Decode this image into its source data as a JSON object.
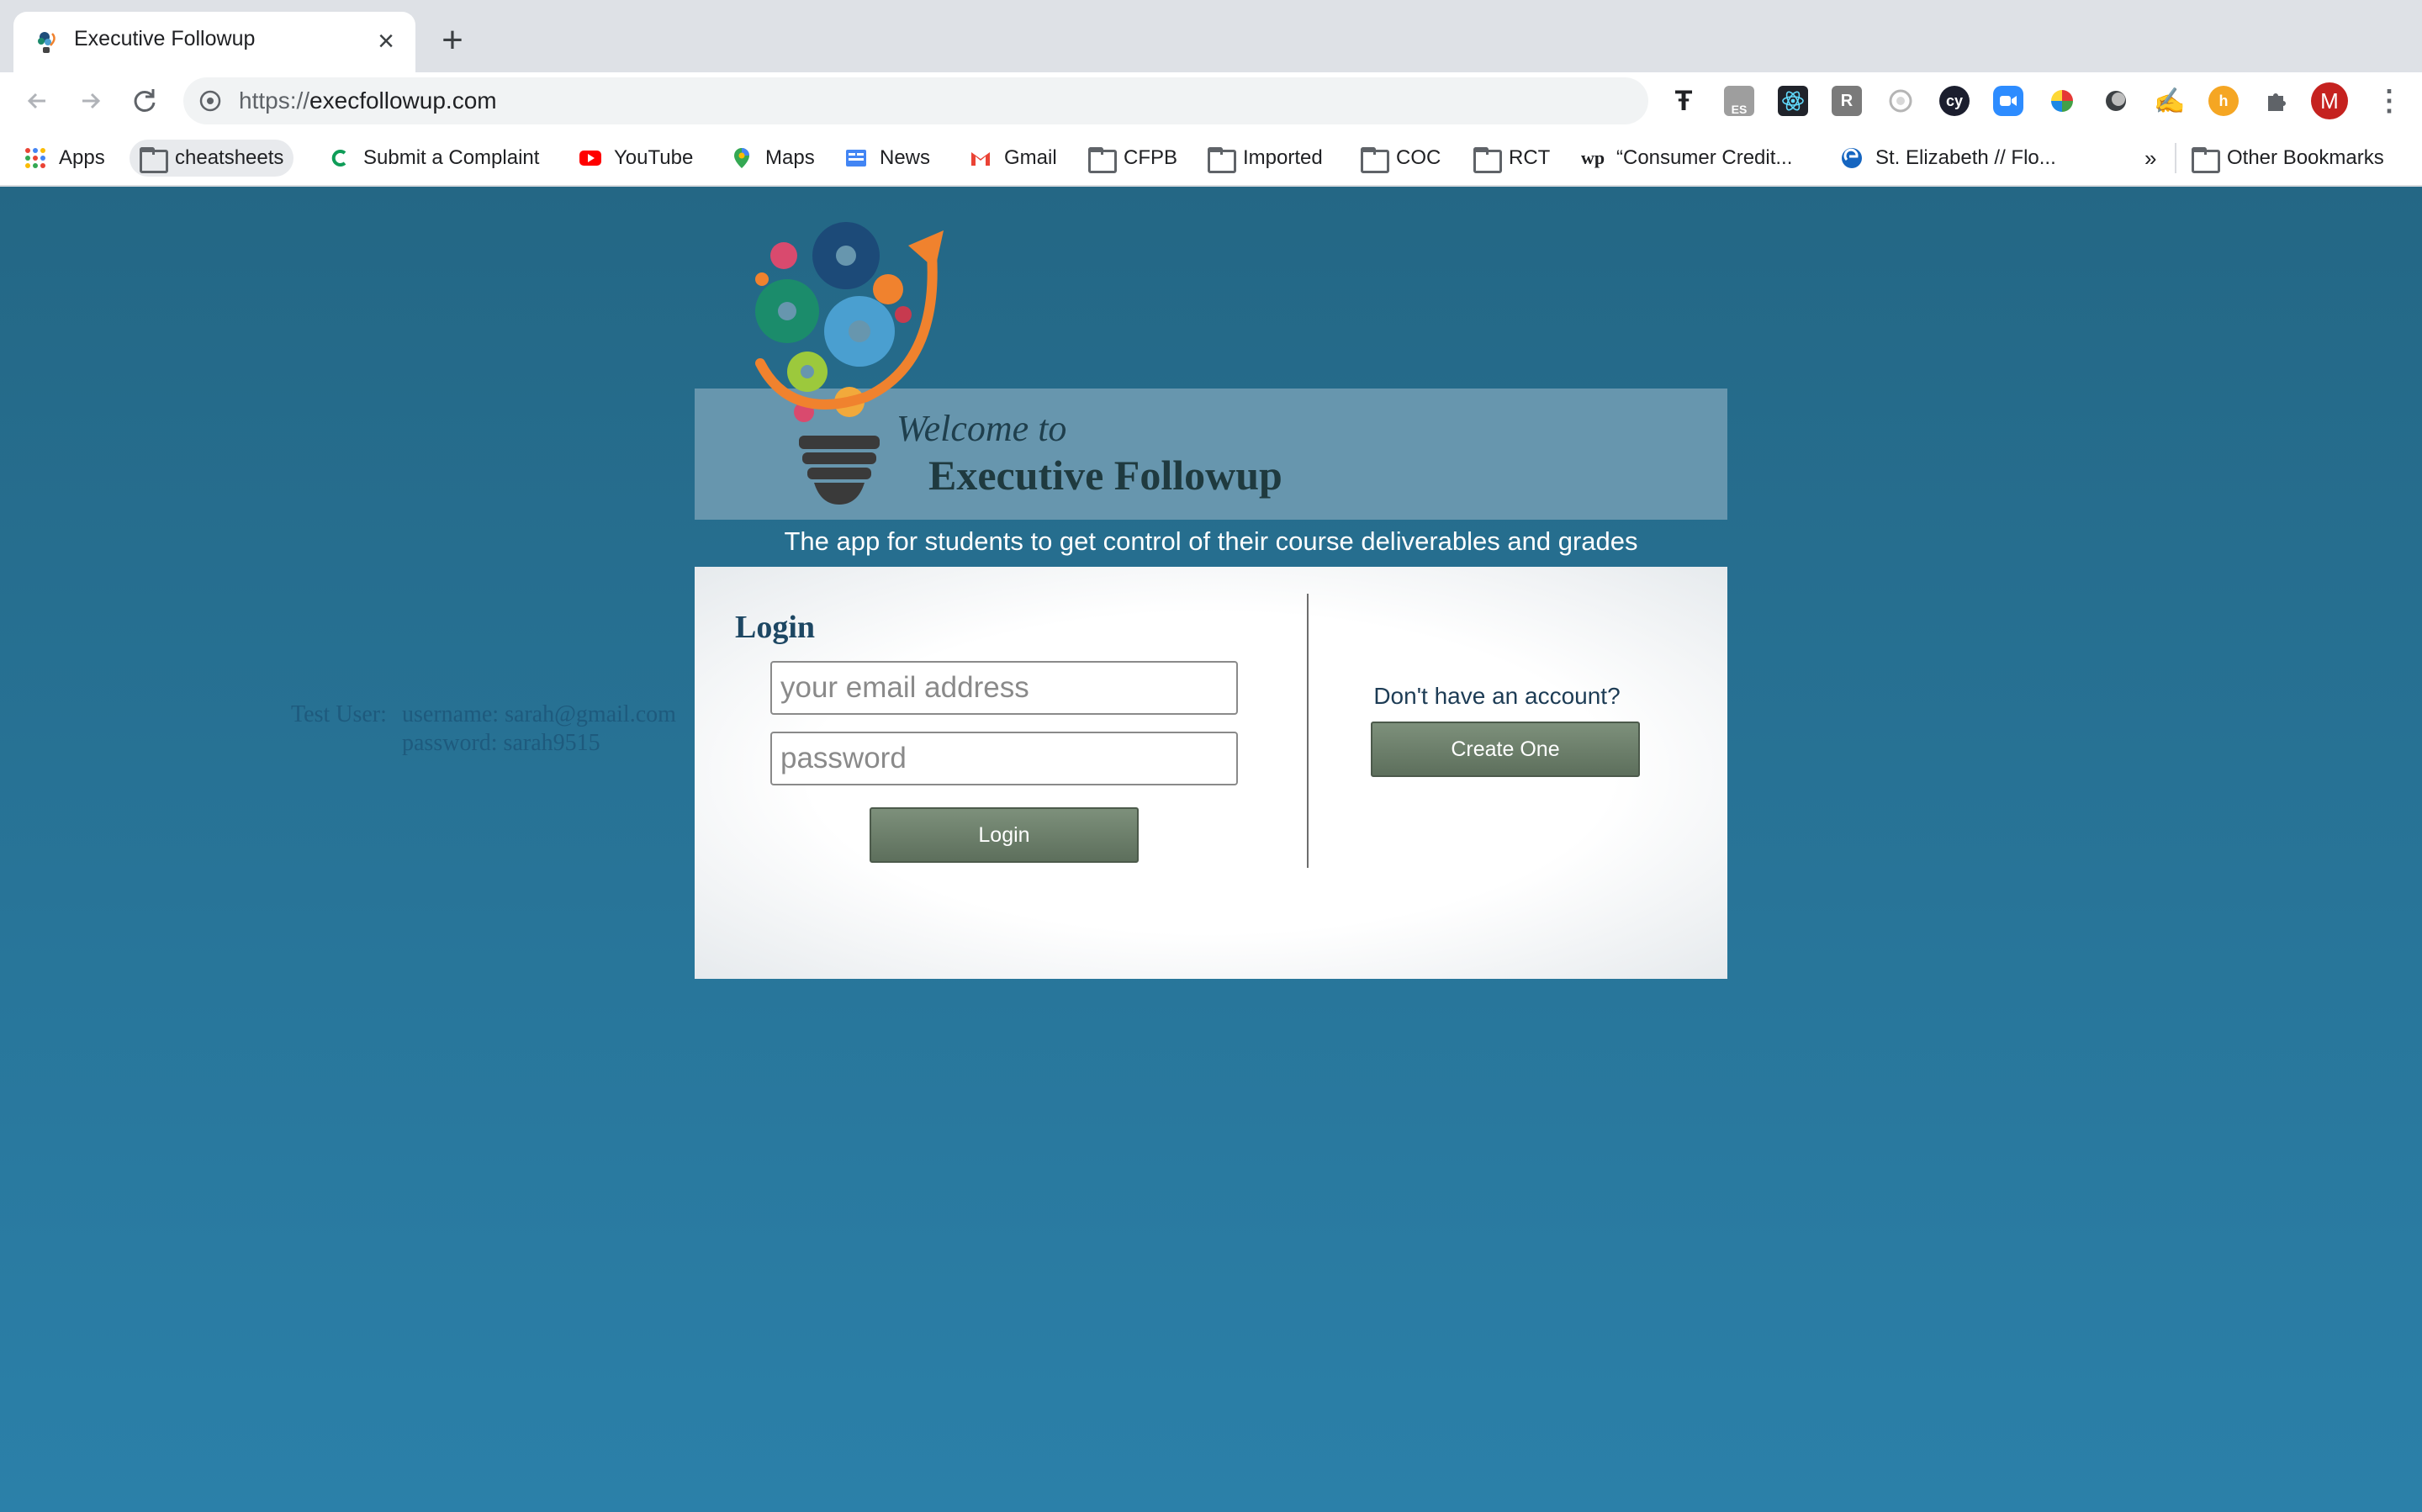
{
  "browser": {
    "tab": {
      "title": "Executive Followup",
      "favicon": "lightbulb-gears-icon"
    },
    "url": {
      "scheme": "https://",
      "host": "execfollowup.com"
    },
    "extensions": [
      "typora",
      "es",
      "react",
      "r",
      "circle",
      "cy",
      "zoom",
      "color-wheel",
      "dark",
      "signature",
      "honey",
      "puzzle"
    ],
    "profile_initial": "M",
    "bookmarks": [
      {
        "label": "Apps",
        "icon": "apps-grid-icon"
      },
      {
        "label": "cheatsheets",
        "icon": "folder-icon"
      },
      {
        "label": "Submit a Complaint",
        "icon": "c-icon"
      },
      {
        "label": "YouTube",
        "icon": "youtube-icon"
      },
      {
        "label": "Maps",
        "icon": "maps-pin-icon"
      },
      {
        "label": "News",
        "icon": "news-icon"
      },
      {
        "label": "Gmail",
        "icon": "gmail-icon"
      },
      {
        "label": "CFPB",
        "icon": "folder-icon"
      },
      {
        "label": "Imported",
        "icon": "folder-icon"
      },
      {
        "label": "COC",
        "icon": "folder-icon"
      },
      {
        "label": "RCT",
        "icon": "folder-icon"
      },
      {
        "label": "“Consumer Credit...",
        "icon": "wp-icon"
      },
      {
        "label": "St. Elizabeth // Flo...",
        "icon": "edge-icon"
      }
    ],
    "overflow": "»",
    "other_bookmarks": "Other Bookmarks"
  },
  "page": {
    "welcome_to": "Welcome to",
    "title": "Executive Followup",
    "tagline": "The app for students to get control of their course deliverables and grades",
    "login": {
      "heading": "Login",
      "email_placeholder": "your email address",
      "password_placeholder": "password",
      "button": "Login"
    },
    "signup": {
      "prompt": "Don't have an account?",
      "button": "Create One"
    },
    "test_user": {
      "label": "Test User:",
      "username": "username: sarah@gmail.com",
      "password": "password: sarah9515"
    }
  }
}
